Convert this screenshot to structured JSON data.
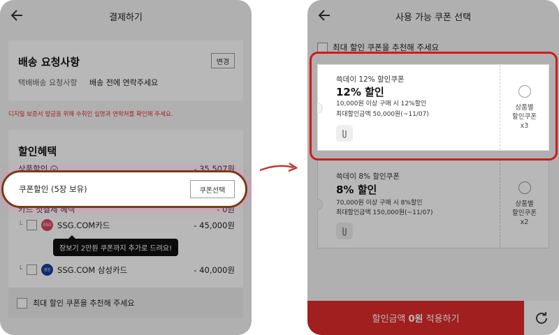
{
  "left": {
    "title": "결제하기",
    "delivery": {
      "title": "배송 요청사항",
      "change_label": "변경",
      "field_label": "택배배송 요청사항",
      "field_value": "배송 전에 연락주세요"
    },
    "notice": "디지털 보증서 발급을 위해 수취인 실명과 연락처를 확인해 주세요.",
    "discount": {
      "title": "할인혜택",
      "product_label": "상품할인",
      "product_value": "- 35,507원",
      "coupon_label": "쿠폰할인 (5장 보유)",
      "coupon_button": "쿠폰선택",
      "card_label": "카드 첫결제 혜택",
      "card_value": "- 0원",
      "cards": [
        {
          "name": "SSG.COM카드",
          "value": "- 45,000원",
          "logo": "SSG"
        },
        {
          "name": "SSG.COM 삼성카드",
          "value": "- 40,000원",
          "logo": "삼성"
        }
      ],
      "tooltip": "장보기 2만원 쿠폰까지 추가로 드려요!"
    },
    "recommend_label": "최대 할인 쿠폰을 추천해 주세요"
  },
  "right": {
    "title": "사용 가능 쿠폰 선택",
    "recommend_label": "최대 할인 쿠폰을 추천해 주세요",
    "coupons": [
      {
        "name": "쓱데이 12% 할인쿠폰",
        "headline": "12% 할인",
        "condition": "10,000원 이상 구매 시 12%할인",
        "max": "최대할인금액 50,000원(~11/07)",
        "side_label": "상품별\n할인쿠폰\nx3"
      },
      {
        "name": "쓱데이 8% 할인쿠폰",
        "headline": "8% 할인",
        "condition": "70,000원 이상 구매 시 8%할인",
        "max": "최대할인금액 150,000원(~11/07)",
        "side_label": "상품별\n할인쿠폰\nx2"
      }
    ],
    "apply_prefix": "할인금액 ",
    "apply_amount": "0원",
    "apply_suffix": " 적용하기"
  },
  "colors": {
    "accent_red": "#e02b2b",
    "highlight_brown": "#7a3b12",
    "highlight_red": "#d11a1a"
  }
}
